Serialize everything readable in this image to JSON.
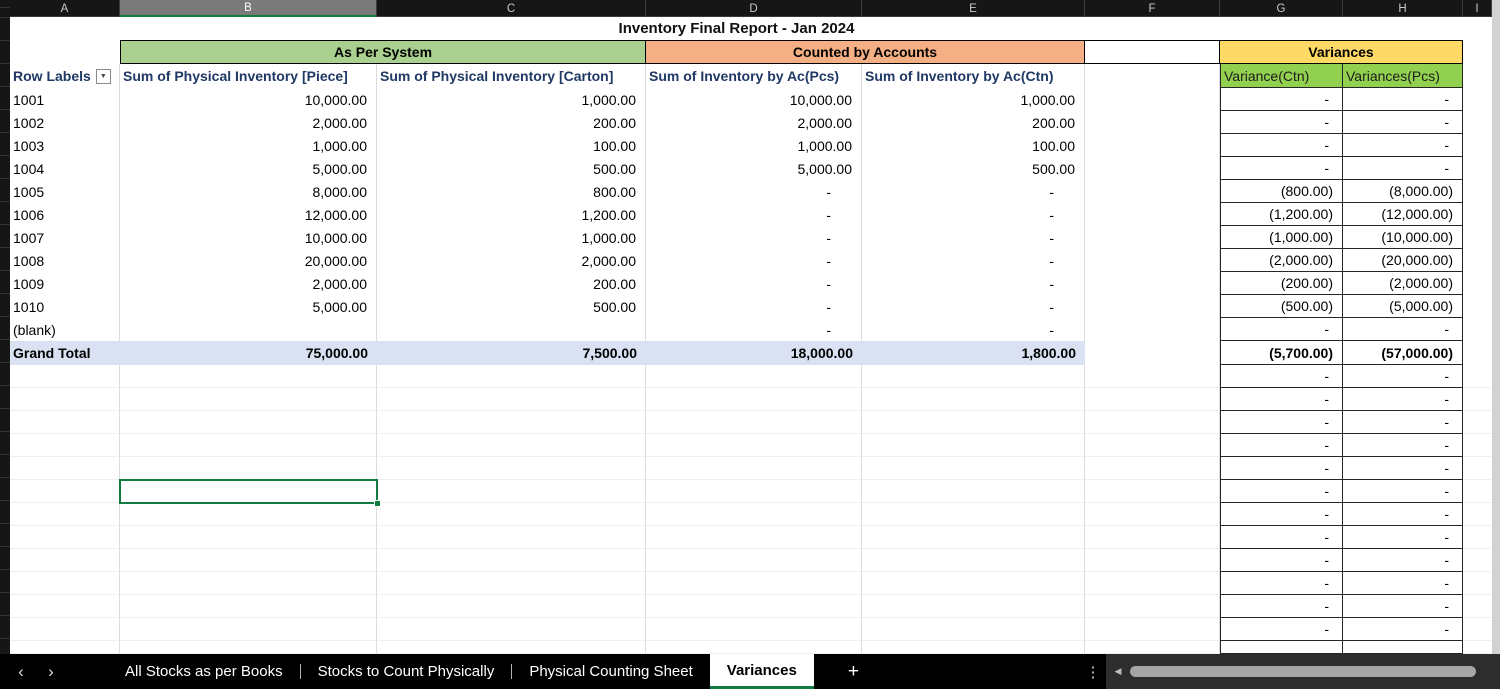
{
  "colors": {
    "group_system_green": "#A9D08E",
    "group_accounts_orange": "#F4B084",
    "group_variances_yellow": "#FFD966",
    "variance_header_green": "#92D050",
    "grand_total_blue": "#D9E1F2",
    "selection_green": "#107C41",
    "active_tab_underline": "#107C41"
  },
  "column_letters": [
    "A",
    "B",
    "C",
    "D",
    "E",
    "F",
    "G",
    "H",
    "I"
  ],
  "selected_column": "B",
  "icons": {
    "filter": "▼",
    "nav_left": "‹",
    "nav_right": "›",
    "add_sheet": "+",
    "more": "⋮",
    "scroll_left": "◀"
  },
  "report": {
    "title": "Inventory Final Report - Jan 2024",
    "groups": {
      "system": "As Per System",
      "accounts": "Counted by Accounts",
      "variances": "Variances"
    },
    "headers": {
      "row_labels": "Row Labels",
      "sys_pieces": "Sum of Physical Inventory [Piece]",
      "sys_cartons": "Sum of Physical Inventory [Carton]",
      "acc_pcs": "Sum of Inventory by Ac(Pcs)",
      "acc_ctn": "Sum of Inventory by Ac(Ctn)",
      "variance_ctn": "Variance(Ctn)",
      "variance_pcs": "Variances(Pcs)"
    },
    "rows": [
      {
        "label": "1001",
        "sys_pieces": "10,000.00",
        "sys_cartons": "1,000.00",
        "acc_pcs": "10,000.00",
        "acc_ctn": "1,000.00",
        "var_ctn": "-",
        "var_pcs": "-"
      },
      {
        "label": "1002",
        "sys_pieces": "2,000.00",
        "sys_cartons": "200.00",
        "acc_pcs": "2,000.00",
        "acc_ctn": "200.00",
        "var_ctn": "-",
        "var_pcs": "-"
      },
      {
        "label": "1003",
        "sys_pieces": "1,000.00",
        "sys_cartons": "100.00",
        "acc_pcs": "1,000.00",
        "acc_ctn": "100.00",
        "var_ctn": "-",
        "var_pcs": "-"
      },
      {
        "label": "1004",
        "sys_pieces": "5,000.00",
        "sys_cartons": "500.00",
        "acc_pcs": "5,000.00",
        "acc_ctn": "500.00",
        "var_ctn": "-",
        "var_pcs": "-"
      },
      {
        "label": "1005",
        "sys_pieces": "8,000.00",
        "sys_cartons": "800.00",
        "acc_pcs": "-",
        "acc_ctn": "-",
        "var_ctn": "(800.00)",
        "var_pcs": "(8,000.00)"
      },
      {
        "label": "1006",
        "sys_pieces": "12,000.00",
        "sys_cartons": "1,200.00",
        "acc_pcs": "-",
        "acc_ctn": "-",
        "var_ctn": "(1,200.00)",
        "var_pcs": "(12,000.00)"
      },
      {
        "label": "1007",
        "sys_pieces": "10,000.00",
        "sys_cartons": "1,000.00",
        "acc_pcs": "-",
        "acc_ctn": "-",
        "var_ctn": "(1,000.00)",
        "var_pcs": "(10,000.00)"
      },
      {
        "label": "1008",
        "sys_pieces": "20,000.00",
        "sys_cartons": "2,000.00",
        "acc_pcs": "-",
        "acc_ctn": "-",
        "var_ctn": "(2,000.00)",
        "var_pcs": "(20,000.00)"
      },
      {
        "label": "1009",
        "sys_pieces": "2,000.00",
        "sys_cartons": "200.00",
        "acc_pcs": "-",
        "acc_ctn": "-",
        "var_ctn": "(200.00)",
        "var_pcs": "(2,000.00)"
      },
      {
        "label": "1010",
        "sys_pieces": "5,000.00",
        "sys_cartons": "500.00",
        "acc_pcs": "-",
        "acc_ctn": "-",
        "var_ctn": "(500.00)",
        "var_pcs": "(5,000.00)"
      },
      {
        "label": "(blank)",
        "sys_pieces": "",
        "sys_cartons": "",
        "acc_pcs": "-",
        "acc_ctn": "-",
        "var_ctn": "-",
        "var_pcs": "-"
      }
    ],
    "grand_total": {
      "label": "Grand Total",
      "sys_pieces": "75,000.00",
      "sys_cartons": "7,500.00",
      "acc_pcs": "18,000.00",
      "acc_ctn": "1,800.00",
      "var_ctn": "(5,700.00)",
      "var_pcs": "(57,000.00)"
    },
    "empty_variance_rows": [
      {
        "var_ctn": "-",
        "var_pcs": "-"
      },
      {
        "var_ctn": "-",
        "var_pcs": "-"
      },
      {
        "var_ctn": "-",
        "var_pcs": "-"
      },
      {
        "var_ctn": "-",
        "var_pcs": "-"
      },
      {
        "var_ctn": "-",
        "var_pcs": "-"
      },
      {
        "var_ctn": "-",
        "var_pcs": "-"
      },
      {
        "var_ctn": "-",
        "var_pcs": "-"
      },
      {
        "var_ctn": "-",
        "var_pcs": "-"
      },
      {
        "var_ctn": "-",
        "var_pcs": "-"
      },
      {
        "var_ctn": "-",
        "var_pcs": "-"
      },
      {
        "var_ctn": "-",
        "var_pcs": "-"
      },
      {
        "var_ctn": "-",
        "var_pcs": "-"
      }
    ]
  },
  "sheet_tabs": [
    {
      "label": "All Stocks as per Books",
      "active": false
    },
    {
      "label": "Stocks to Count Physically",
      "active": false
    },
    {
      "label": "Physical Counting Sheet",
      "active": false
    },
    {
      "label": "Variances",
      "active": true
    }
  ]
}
